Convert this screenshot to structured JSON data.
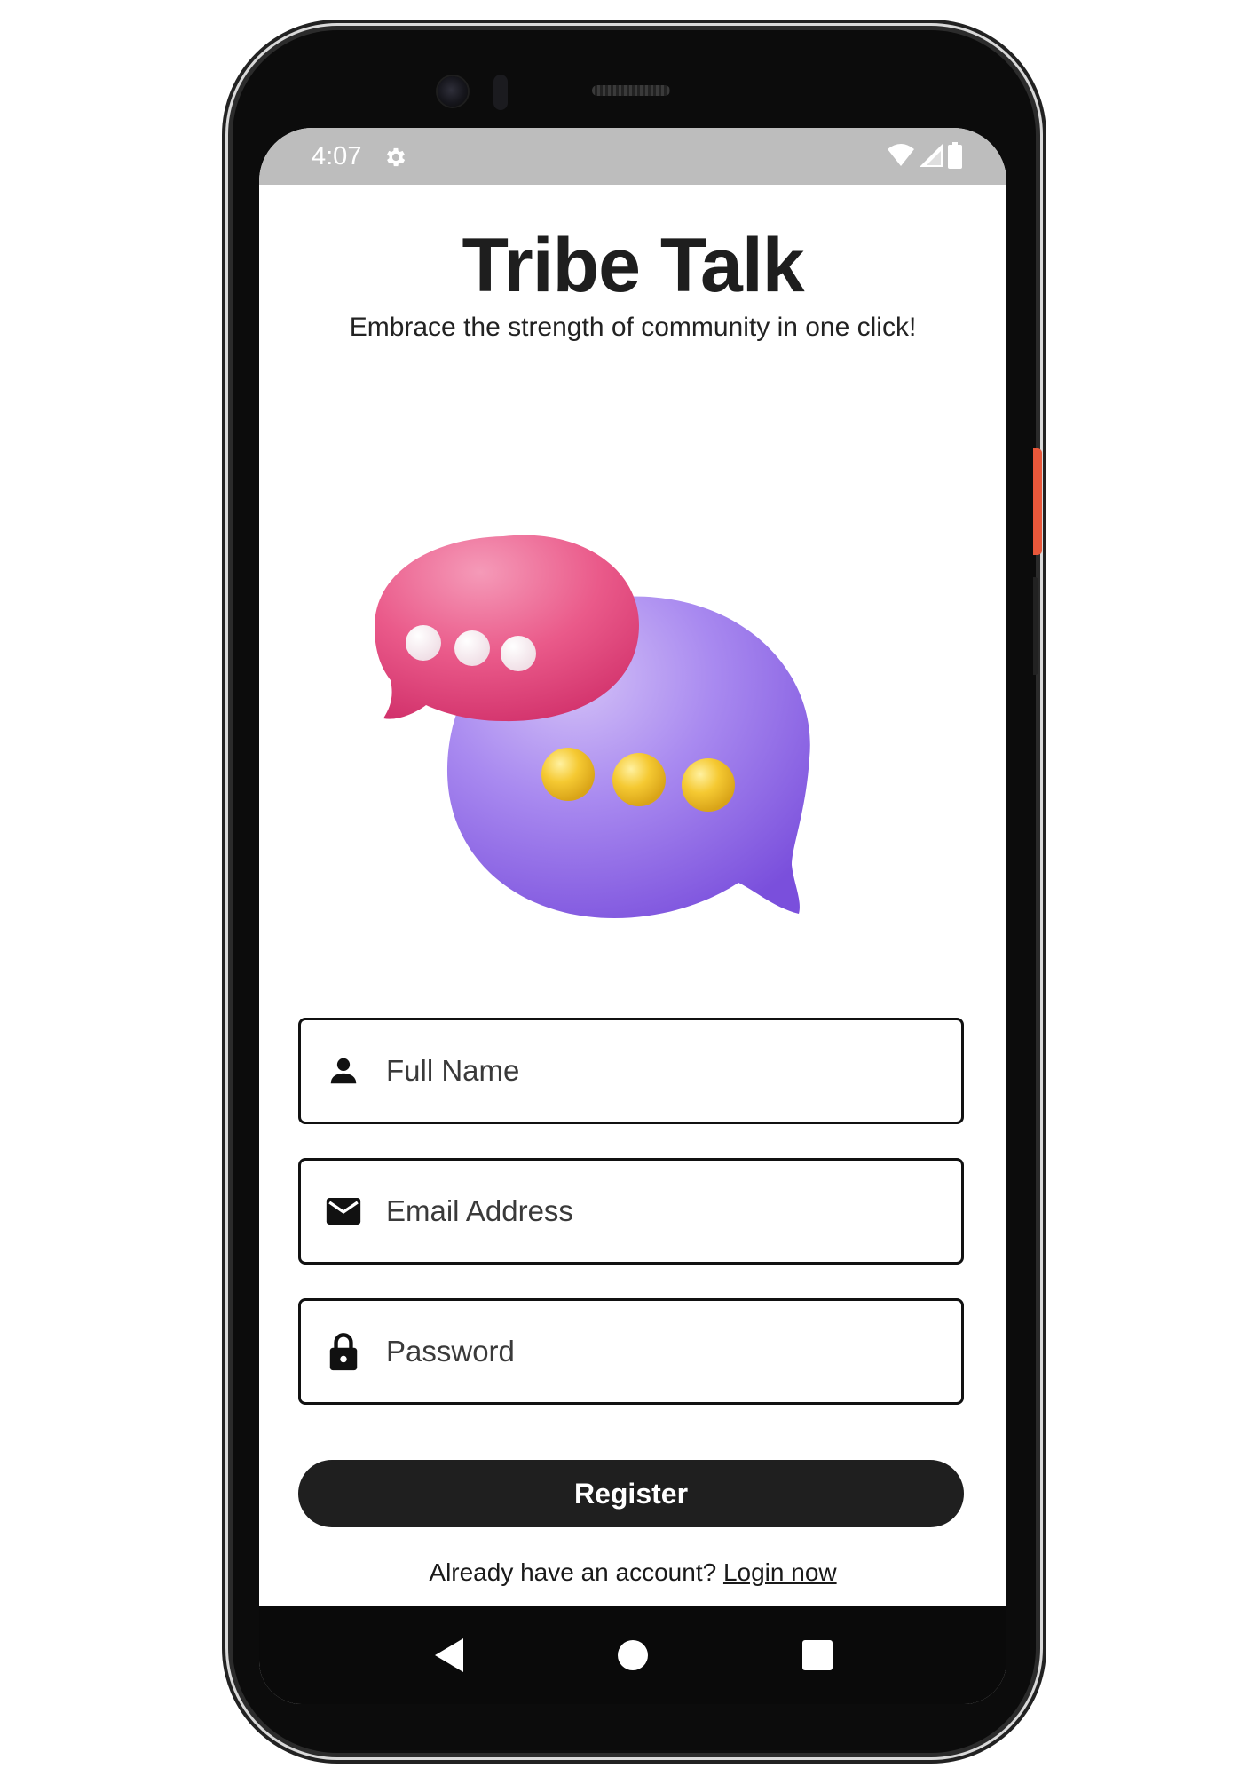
{
  "status_bar": {
    "time": "4:07",
    "settings_icon": "gear-icon",
    "wifi_icon": "wifi-icon",
    "signal_icon": "signal-icon",
    "battery_icon": "battery-icon"
  },
  "header": {
    "title": "Tribe Talk",
    "subtitle": "Embrace the strength of community in one click!"
  },
  "hero": {
    "image": "chat-bubbles-illustration",
    "colors": {
      "pink_bubble": "#e8487a",
      "purple_bubble": "#8e6ee8",
      "yellow_dots": "#f2c230"
    }
  },
  "form": {
    "full_name": {
      "icon": "person-icon",
      "placeholder": "Full Name",
      "value": ""
    },
    "email": {
      "icon": "mail-icon",
      "placeholder": "Email Address",
      "value": ""
    },
    "password": {
      "icon": "lock-icon",
      "placeholder": "Password",
      "value": ""
    },
    "register_label": "Register"
  },
  "footer": {
    "prompt": "Already have an account?",
    "link": "Login now"
  },
  "nav_bar": {
    "back_icon": "back-triangle-icon",
    "home_icon": "home-circle-icon",
    "recents_icon": "recents-square-icon"
  },
  "theme": {
    "accent": "#1f1f1f",
    "status_bar": "#bdbdbd"
  }
}
